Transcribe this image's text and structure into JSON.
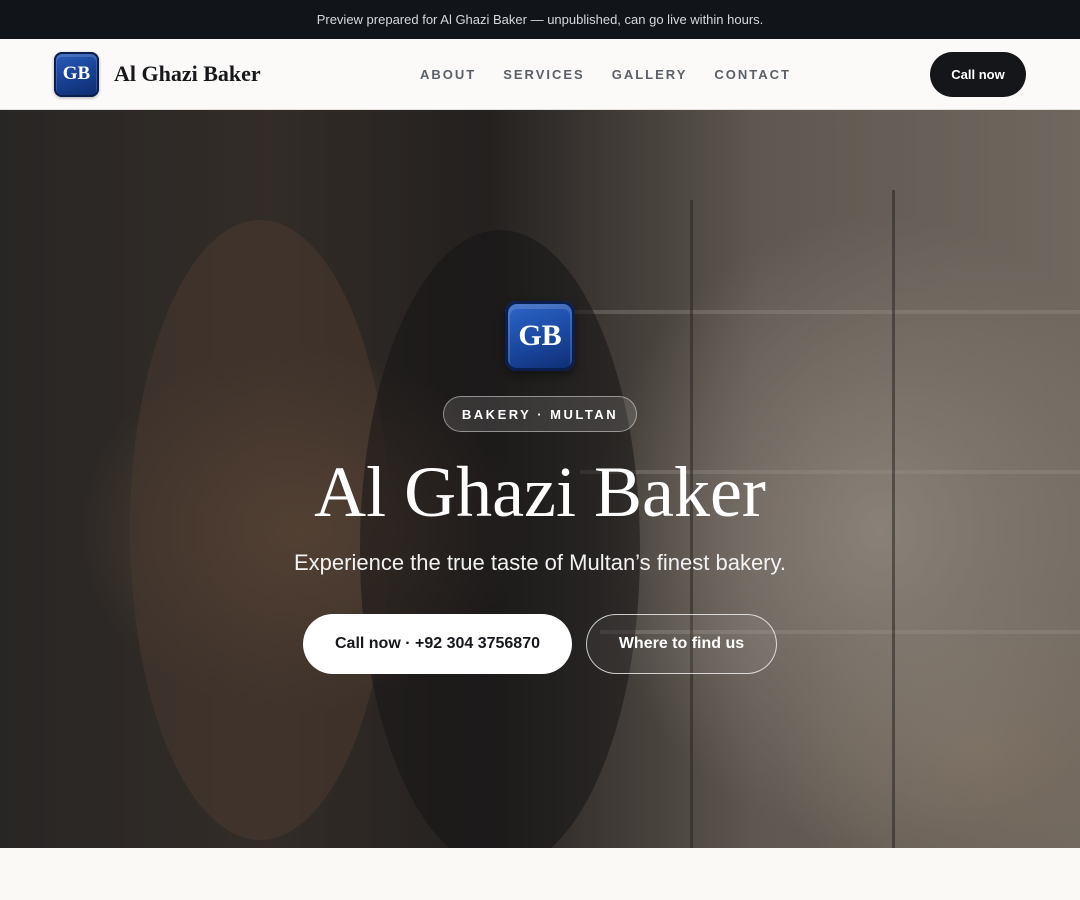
{
  "announcement": "Preview prepared for Al Ghazi Baker — unpublished, can go live within hours.",
  "header": {
    "logo_text": "GB",
    "brand_name": "Al Ghazi Baker",
    "nav": [
      {
        "label": "ABOUT"
      },
      {
        "label": "SERVICES"
      },
      {
        "label": "GALLERY"
      },
      {
        "label": "CONTACT"
      }
    ],
    "cta_label": "Call now"
  },
  "hero": {
    "logo_text": "GB",
    "tagline": "BAKERY · MULTAN",
    "title": "Al Ghazi Baker",
    "subtitle": "Experience the true taste of Multan’s finest bakery.",
    "primary_button": "Call now · +92 304 3756870",
    "secondary_button": "Where to find us"
  },
  "colors": {
    "brand_blue": "#1a48a0",
    "dark": "#14161a",
    "page_background": "#faf9f6"
  }
}
